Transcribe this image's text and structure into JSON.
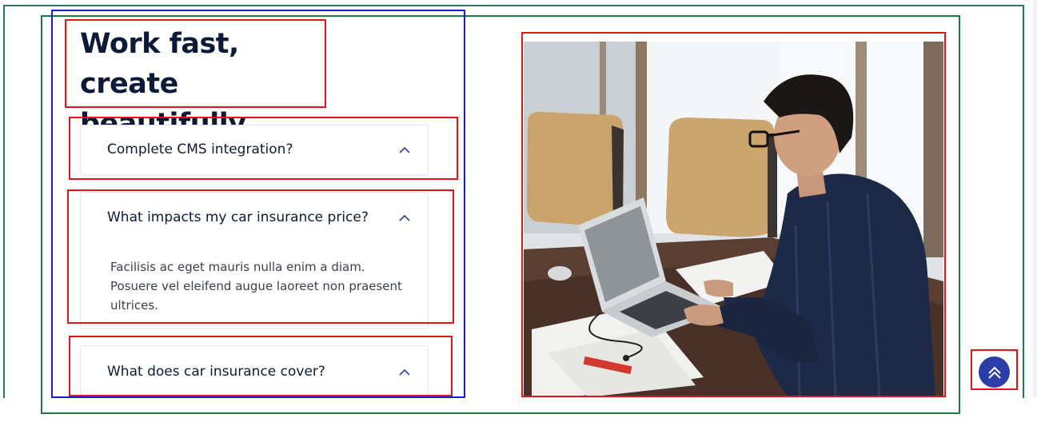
{
  "section": {
    "heading": "Work fast, create beautifully."
  },
  "faq": {
    "items": [
      {
        "question": "Complete CMS integration?",
        "answer": "",
        "expanded": false
      },
      {
        "question": "What impacts my car insurance price?",
        "answer": "Facilisis ac eget mauris nulla enim a diam. Posuere vel eleifend augue laoreet non praesent ultrices.",
        "expanded": true
      },
      {
        "question": "What does car insurance cover?",
        "answer": "",
        "expanded": false
      }
    ]
  },
  "image": {
    "icon": "office-photo-man-laptop"
  },
  "scroll_to_top": {
    "icon": "double-chevron-up-icon",
    "color": "#2b3ea8"
  },
  "colors": {
    "heading": "#0c1a3a",
    "chevron": "#2b3ea8",
    "annotation_red": "#e01515",
    "annotation_blue": "#1a1fd6",
    "annotation_green": "#1b7a3e",
    "annotation_teal": "#1f7a66"
  }
}
